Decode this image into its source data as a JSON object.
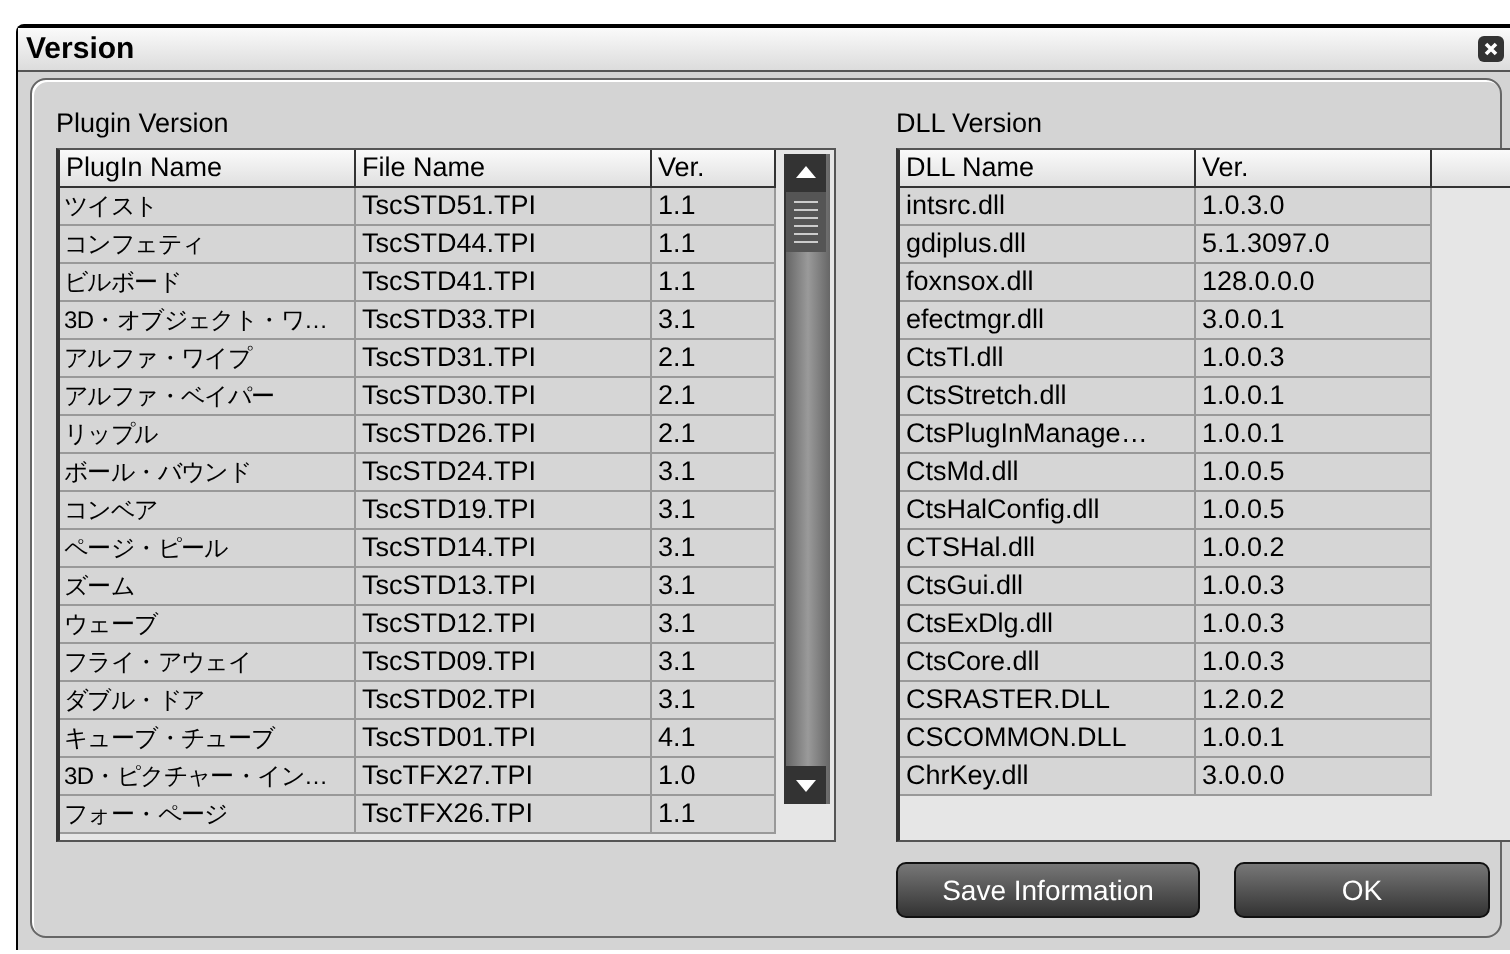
{
  "window": {
    "title": "Version"
  },
  "plugin_section": {
    "label": "Plugin Version",
    "columns": [
      "PlugIn Name",
      "File Name",
      "Ver."
    ],
    "rows": [
      [
        "ツイスト",
        "TscSTD51.TPI",
        "1.1"
      ],
      [
        "コンフェティ",
        "TscSTD44.TPI",
        "1.1"
      ],
      [
        "ビルボード",
        "TscSTD41.TPI",
        "1.1"
      ],
      [
        "3D・オブジェクト・ワ…",
        "TscSTD33.TPI",
        "3.1"
      ],
      [
        "アルファ・ワイプ",
        "TscSTD31.TPI",
        "2.1"
      ],
      [
        "アルファ・ベイパー",
        "TscSTD30.TPI",
        "2.1"
      ],
      [
        "リップル",
        "TscSTD26.TPI",
        "2.1"
      ],
      [
        "ボール・バウンド",
        "TscSTD24.TPI",
        "3.1"
      ],
      [
        "コンベア",
        "TscSTD19.TPI",
        "3.1"
      ],
      [
        "ページ・ピール",
        "TscSTD14.TPI",
        "3.1"
      ],
      [
        "ズーム",
        "TscSTD13.TPI",
        "3.1"
      ],
      [
        "ウェーブ",
        "TscSTD12.TPI",
        "3.1"
      ],
      [
        "フライ・アウェイ",
        "TscSTD09.TPI",
        "3.1"
      ],
      [
        "ダブル・ドア",
        "TscSTD02.TPI",
        "3.1"
      ],
      [
        "キューブ・チューブ",
        "TscSTD01.TPI",
        "4.1"
      ],
      [
        "3D・ピクチャー・イン…",
        "TscTFX27.TPI",
        "1.0"
      ],
      [
        "フォー・ページ",
        "TscTFX26.TPI",
        "1.1"
      ]
    ]
  },
  "dll_section": {
    "label": "DLL Version",
    "columns": [
      "DLL Name",
      "Ver."
    ],
    "rows": [
      [
        "intsrc.dll",
        "1.0.3.0"
      ],
      [
        "gdiplus.dll",
        "5.1.3097.0"
      ],
      [
        "foxnsox.dll",
        "128.0.0.0"
      ],
      [
        "efectmgr.dll",
        "3.0.0.1"
      ],
      [
        "CtsTl.dll",
        "1.0.0.3"
      ],
      [
        "CtsStretch.dll",
        "1.0.0.1"
      ],
      [
        "CtsPlugInManage…",
        "1.0.0.1"
      ],
      [
        "CtsMd.dll",
        "1.0.0.5"
      ],
      [
        "CtsHalConfig.dll",
        "1.0.0.5"
      ],
      [
        "CTSHal.dll",
        "1.0.0.2"
      ],
      [
        "CtsGui.dll",
        "1.0.0.3"
      ],
      [
        "CtsExDlg.dll",
        "1.0.0.3"
      ],
      [
        "CtsCore.dll",
        "1.0.0.3"
      ],
      [
        "CSRASTER.DLL",
        "1.2.0.2"
      ],
      [
        "CSCOMMON.DLL",
        "1.0.0.1"
      ],
      [
        "ChrKey.dll",
        "3.0.0.0"
      ]
    ]
  },
  "buttons": [
    "Save Information",
    "OK"
  ]
}
